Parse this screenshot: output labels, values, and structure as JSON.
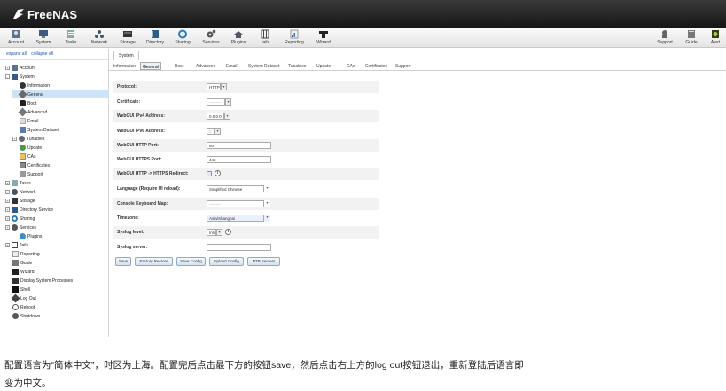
{
  "header": {
    "logo_text": "FreeNAS"
  },
  "toolbar": {
    "items": [
      "Account",
      "System",
      "Tasks",
      "Network",
      "Storage",
      "Directory",
      "Sharing",
      "Services",
      "Plugins",
      "Jails",
      "Reporting",
      "Wizard"
    ],
    "right_items": [
      "Support",
      "Guide",
      "Alert"
    ]
  },
  "tree": {
    "expand_all": "expand all",
    "collapse_all": "collapse all",
    "items": [
      "Account",
      "System",
      "Information",
      "General",
      "Boot",
      "Advanced",
      "Email",
      "System Dataset",
      "Tunables",
      "Update",
      "CAs",
      "Certificates",
      "Support",
      "Tasks",
      "Network",
      "Storage",
      "Directory Service",
      "Sharing",
      "Services",
      "Plugins",
      "Jails",
      "Reporting",
      "Guide",
      "Wizard",
      "Display System Processes",
      "Shell",
      "Log Out",
      "Reboot",
      "Shutdown"
    ]
  },
  "panel": {
    "top_tab": "System",
    "subtabs": [
      "Information",
      "General",
      "Boot",
      "Advanced",
      "Email",
      "System Dataset",
      "Tunables",
      "Update",
      "CAs",
      "Certificates",
      "Support"
    ],
    "fields": {
      "protocol_label": "Protocol:",
      "protocol_value": "HTTP",
      "certificate_label": "Certificate:",
      "certificate_value": "---------",
      "ipv4_label": "WebGUI IPv4 Address:",
      "ipv4_value": "0.0.0.0",
      "ipv6_label": "WebGUI IPv6 Address:",
      "ipv6_value": "::",
      "http_port_label": "WebGUI HTTP Port:",
      "http_port_value": "80",
      "https_port_label": "WebGUI HTTPS Port:",
      "https_port_value": "443",
      "redirect_label": "WebGUI HTTP -> HTTPS Redirect:",
      "language_label": "Language (Require UI reload):",
      "language_value": "Simplified Chinese",
      "keyboard_label": "Console Keyboard Map:",
      "keyboard_value": "---------",
      "timezone_label": "Timezone:",
      "timezone_value": "Asia/Shanghai",
      "syslog_level_label": "Syslog level:",
      "syslog_level_value": "Info",
      "syslog_server_label": "Syslog server:"
    },
    "buttons": [
      "Save",
      "Factory Restore",
      "Save Config",
      "Upload Config",
      "NTP Servers"
    ],
    "help_glyph": "i"
  },
  "caption": {
    "line1": "配置语言为“简体中文”，时区为上海。配置完后点击最下方的按钮save，然后点击右上方的log out按钮退出，重新登陆后语言即",
    "line2": "变为中文。"
  }
}
